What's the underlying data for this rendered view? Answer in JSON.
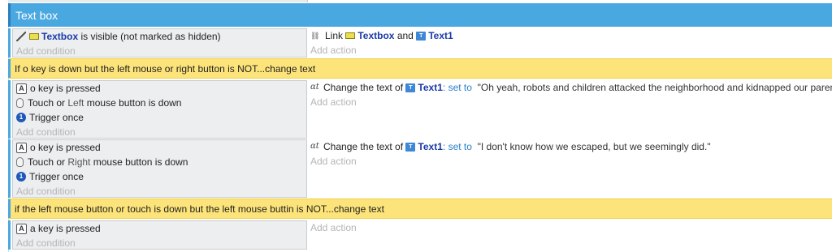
{
  "group": {
    "title": "Text box"
  },
  "events": [
    {
      "conditions": [
        {
          "icon": "visible-icon",
          "object": "Textbox",
          "text": "is visible (not marked as hidden)"
        }
      ],
      "add_condition": "Add condition",
      "actions": [
        {
          "icon": "link-icon",
          "prefix": "Link",
          "object1": "Textbox",
          "connector": "and",
          "object2": "Text1"
        }
      ],
      "add_action": "Add action"
    },
    {
      "conditions": [
        {
          "icon": "key-icon",
          "key_label": "A",
          "key": "o",
          "text": "key is pressed"
        },
        {
          "icon": "mouse-icon",
          "pre": "Touch or",
          "param": "Left",
          "post": "mouse button is down"
        },
        {
          "icon": "trigger-once-icon",
          "text": "Trigger once"
        }
      ],
      "add_condition": "Add condition",
      "actions": [
        {
          "icon": "text-icon",
          "pre": "Change the text of",
          "object": "Text1",
          "sep": ":",
          "kw": "set to",
          "value": "\"Oh yeah, robots and children attacked the neighborhood and kidnapped our parents.\""
        }
      ],
      "add_action": "Add action"
    },
    {
      "conditions": [
        {
          "icon": "key-icon",
          "key_label": "A",
          "key": "o",
          "text": "key is pressed"
        },
        {
          "icon": "mouse-icon",
          "pre": "Touch or",
          "param": "Right",
          "post": "mouse button is down"
        },
        {
          "icon": "trigger-once-icon",
          "text": "Trigger once"
        }
      ],
      "add_condition": "Add condition",
      "actions": [
        {
          "icon": "text-icon",
          "pre": "Change the text of",
          "object": "Text1",
          "sep": ":",
          "kw": "set to",
          "value": "\"I don't know how we escaped, but we seemingly did.\""
        }
      ],
      "add_action": "Add action"
    },
    {
      "conditions": [
        {
          "icon": "key-icon",
          "key_label": "A",
          "key": "a",
          "text": "key is pressed"
        }
      ],
      "add_condition": "Add condition",
      "actions": [],
      "add_action": "Add action"
    }
  ],
  "comments": [
    "If o key is down but the left mouse or right button is NOT...change text",
    "if the left mouse button or touch is down but the left mouse buttin is NOT...change text"
  ],
  "icons": {
    "textbox_object_icon": "textbox-object-icon",
    "text_object_icon": "text-object-icon",
    "trigger_once_glyph": "1"
  },
  "colors": {
    "group_header": "#4aa8e0",
    "comment_bg": "#fde47a",
    "condition_bg": "#eceef0",
    "object_name": "#1a3aa6",
    "keyword": "#2a7ecb"
  }
}
